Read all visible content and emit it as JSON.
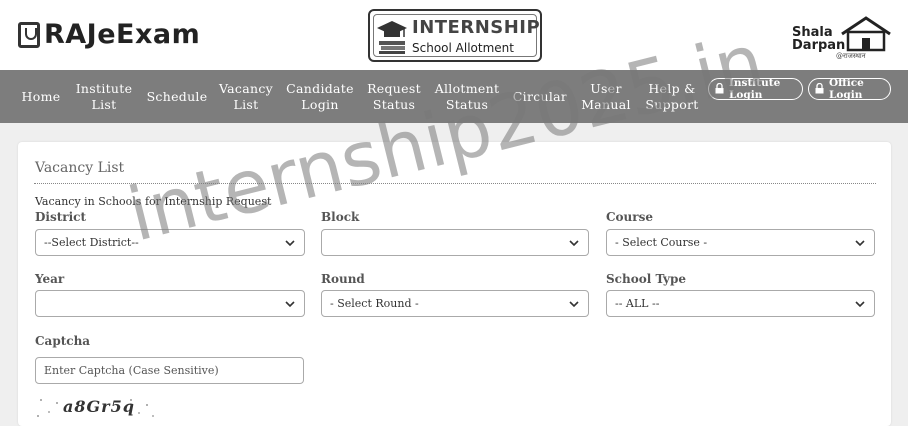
{
  "header": {
    "logo": "RAJeExam",
    "internship_title": "INTERNSHIP",
    "internship_subtitle": "School Allotment",
    "shala_line1": "Shala",
    "shala_line2": "Darpan",
    "shala_line3": "@राजस्थान"
  },
  "nav": {
    "items": [
      {
        "label": "Home"
      },
      {
        "label": "Institute\nList"
      },
      {
        "label": "Schedule"
      },
      {
        "label": "Vacancy\nList"
      },
      {
        "label": "Candidate\nLogin"
      },
      {
        "label": "Request\nStatus"
      },
      {
        "label": "Allotment\nStatus"
      },
      {
        "label": "Circular"
      },
      {
        "label": "User\nManual"
      },
      {
        "label": "Help &\nSupport"
      }
    ],
    "institute_login": "Institute Login",
    "office_login": "Office Login"
  },
  "form": {
    "title": "Vacancy List",
    "subtitle": "Vacancy in Schools for Internship Request",
    "district_label": "District",
    "district_value": "--Select District--",
    "block_label": "Block",
    "block_value": "",
    "course_label": "Course",
    "course_value": "- Select Course -",
    "year_label": "Year",
    "year_value": "",
    "round_label": "Round",
    "round_value": "- Select Round -",
    "school_type_label": "School Type",
    "school_type_value": "-- ALL --",
    "captcha_label": "Captcha",
    "captcha_placeholder": "Enter Captcha (Case Sensitive)",
    "captcha_text": "a8Gr5q"
  },
  "watermark": "internship2025.in",
  "colors": {
    "nav_bg": "#7d7d7d",
    "page_bg": "#efefef"
  }
}
